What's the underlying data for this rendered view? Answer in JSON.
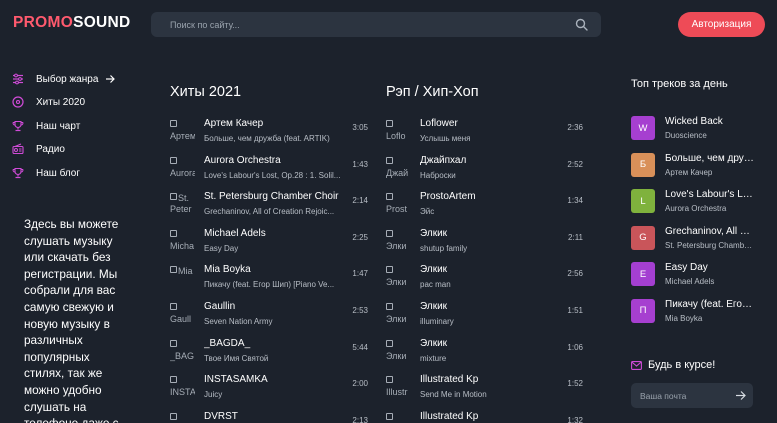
{
  "header": {
    "logo_promo": "PROMO",
    "logo_sound": "SOUND",
    "search_placeholder": "Поиск по сайту...",
    "login_label": "Авторизация",
    "accent": "#ee4b57"
  },
  "sidebar": {
    "items": [
      {
        "label": "Выбор жанра",
        "icon": "equalizer-icon"
      },
      {
        "label": "Хиты 2020",
        "icon": "disc-icon"
      },
      {
        "label": "Наш чарт",
        "icon": "trophy-icon"
      },
      {
        "label": "Радио",
        "icon": "radio-icon"
      },
      {
        "label": "Наш блог",
        "icon": "trophy-icon"
      }
    ],
    "about": "Здесь вы можете слушать музыку или скачать без регистрации. Мы собрали для вас самую свежую и новую музыку в различных популярных стилях, так же можно удобно слушать на телефоне даже с"
  },
  "hits": {
    "title": "Хиты 2021",
    "tracks": [
      {
        "alt": "Артем",
        "title": "Артем Качер",
        "artist": "Больше, чем дружба (feat. ARTIK)",
        "duration": "3:05"
      },
      {
        "alt": "Aurora",
        "title": "Aurora Orchestra",
        "artist": "Love's Labour's Lost, Op.28 : 1. Solil...",
        "duration": "1:43"
      },
      {
        "alt": "St. Peter",
        "title": "St. Petersburg Chamber Choir",
        "artist": "Grechaninov, All of Creation Rejoic...",
        "duration": "2:14"
      },
      {
        "alt": "Micha",
        "title": "Michael Adels",
        "artist": "Easy Day",
        "duration": "2:25"
      },
      {
        "alt": "Mia",
        "title": "Mia Boyka",
        "artist": "Пикачу (feat. Егор Шип) [Piano Ve...",
        "duration": "1:47"
      },
      {
        "alt": "Gaull",
        "title": "Gaullin",
        "artist": "Seven Nation Army",
        "duration": "2:53"
      },
      {
        "alt": "_BAG",
        "title": "_BAGDA_",
        "artist": "Твое Имя Святой",
        "duration": "5:44"
      },
      {
        "alt": "INSTA",
        "title": "INSTASAMKA",
        "artist": "Juicy",
        "duration": "2:00"
      },
      {
        "alt": "DVRS",
        "title": "DVRST",
        "artist": "",
        "duration": "2:13"
      }
    ]
  },
  "rap": {
    "title": "Рэп / Хип-Хоп",
    "tracks": [
      {
        "alt": "Loflo",
        "title": "Loflower",
        "artist": "Услышь меня",
        "duration": "2:36"
      },
      {
        "alt": "Джай",
        "title": "Джайпхал",
        "artist": "Наброски",
        "duration": "2:52"
      },
      {
        "alt": "Prost",
        "title": "ProstoArtem",
        "artist": "Эйс",
        "duration": "1:34"
      },
      {
        "alt": "Элки",
        "title": "Элкик",
        "artist": "shutup family",
        "duration": "2:11"
      },
      {
        "alt": "Элки",
        "title": "Элкик",
        "artist": "pac man",
        "duration": "2:56"
      },
      {
        "alt": "Элки",
        "title": "Элкик",
        "artist": "illuminary",
        "duration": "1:51"
      },
      {
        "alt": "Элки",
        "title": "Элкик",
        "artist": "mixture",
        "duration": "1:06"
      },
      {
        "alt": "Illustr",
        "title": "Illustrated Kp",
        "artist": "Send Me in Motion",
        "duration": "1:52"
      },
      {
        "alt": "Illustr",
        "title": "Illustrated Kp",
        "artist": "",
        "duration": "1:32"
      }
    ]
  },
  "top": {
    "title": "Топ треков за день",
    "items": [
      {
        "letter": "W",
        "name": "Wicked Back",
        "artist": "Duoscience",
        "color": "#a63fd0"
      },
      {
        "letter": "Б",
        "name": "Больше, чем дружба",
        "artist": "Артем Качер",
        "color": "#d99059"
      },
      {
        "letter": "L",
        "name": "Love's Labour's Lost",
        "artist": "Aurora Orchestra",
        "color": "#7fb23d"
      },
      {
        "letter": "G",
        "name": "Grechaninov, All of Creation",
        "artist": "St. Petersburg Chamber Choir",
        "color": "#c9555a"
      },
      {
        "letter": "E",
        "name": "Easy Day",
        "artist": "Michael Adels",
        "color": "#a43fd1"
      },
      {
        "letter": "П",
        "name": "Пикачу (feat. Егор Шип)",
        "artist": "Mia Boyka",
        "color": "#a63fd0"
      }
    ]
  },
  "subscribe": {
    "title": "Будь в курсе!",
    "placeholder": "Ваша почта"
  }
}
